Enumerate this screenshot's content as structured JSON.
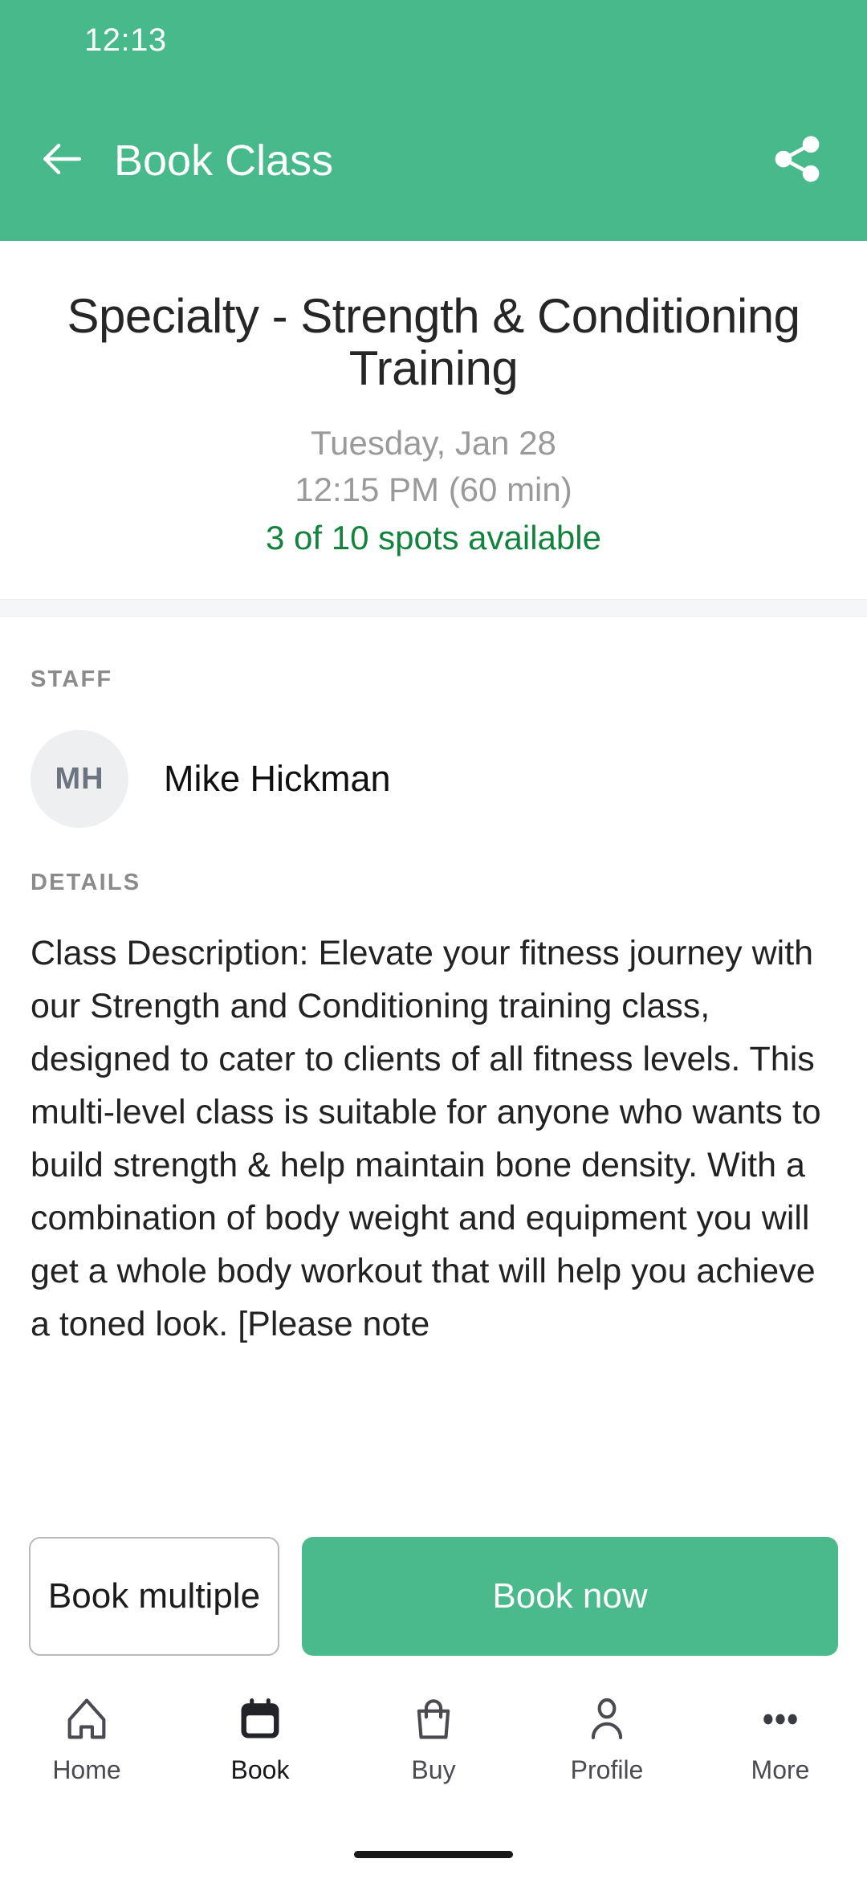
{
  "theme": {
    "brand_green": "#48B98A",
    "spots_green": "#12833C",
    "muted_gray": "#9A9A9A",
    "label_gray": "#8B8B8B"
  },
  "status_bar": {
    "clock": "12:13"
  },
  "app_bar": {
    "back_icon": "arrow-left-icon",
    "title": "Book Class",
    "share_icon": "share-icon"
  },
  "class_header": {
    "title": "Specialty - Strength & Conditioning Training",
    "date": "Tuesday, Jan 28",
    "time": "12:15 PM (60 min)",
    "spots": "3 of 10 spots available"
  },
  "staff": {
    "section_label": "STAFF",
    "avatar_initials": "MH",
    "name": "Mike Hickman"
  },
  "details": {
    "section_label": "DETAILS",
    "description": "Class Description: Elevate your fitness journey with our Strength and Conditioning training class, designed to cater to clients of all fitness levels. This multi-level class is suitable for anyone who wants to build strength & help maintain bone density. With a combination of body weight and equipment you will get a whole body workout that will help you achieve a toned look. [Please note"
  },
  "actions": {
    "book_multiple_label": "Book multiple",
    "book_now_label": "Book now"
  },
  "bottom_nav": {
    "items": [
      {
        "label": "Home",
        "icon": "home-icon",
        "active": false
      },
      {
        "label": "Book",
        "icon": "calendar-icon",
        "active": true
      },
      {
        "label": "Buy",
        "icon": "bag-icon",
        "active": false
      },
      {
        "label": "Profile",
        "icon": "person-icon",
        "active": false
      },
      {
        "label": "More",
        "icon": "ellipsis-icon",
        "active": false
      }
    ]
  }
}
